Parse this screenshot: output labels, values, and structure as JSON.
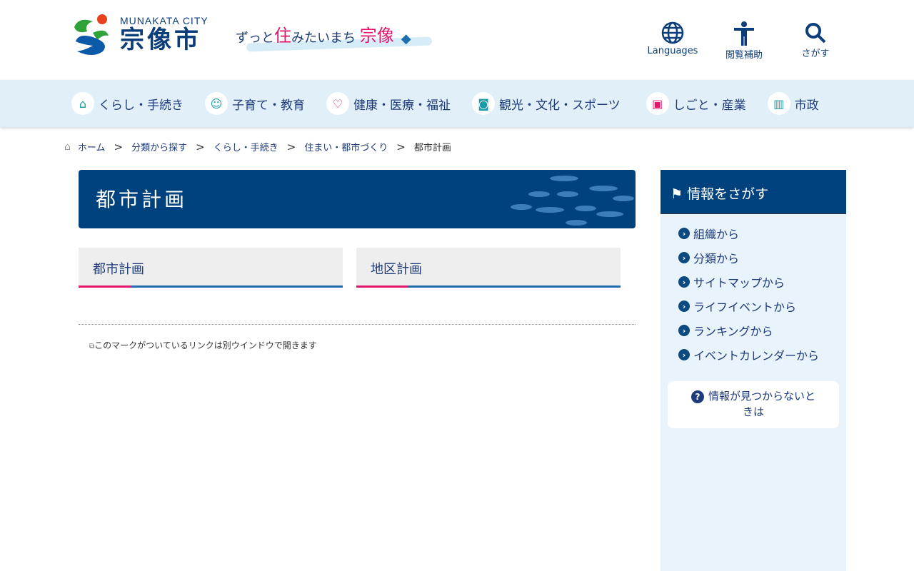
{
  "header": {
    "logo_en": "MUNAKATA CITY",
    "logo_jp": "宗像市",
    "slogan_1": "ずっと",
    "slogan_pk1": "住",
    "slogan_2": "みたいまち",
    "slogan_pk2": "宗像",
    "tools": [
      {
        "label": "Languages",
        "icon": "globe-icon"
      },
      {
        "label": "閲覧補助",
        "icon": "accessibility-icon"
      },
      {
        "label": "さがす",
        "icon": "search-icon"
      }
    ]
  },
  "nav": [
    {
      "label": "くらし・手続き",
      "icon": "house-icon"
    },
    {
      "label": "子育て・教育",
      "icon": "baby-icon"
    },
    {
      "label": "健康・医療・福祉",
      "icon": "heart-hand-icon"
    },
    {
      "label": "観光・文化・スポーツ",
      "icon": "camera-icon"
    },
    {
      "label": "しごと・産業",
      "icon": "briefcase-icon"
    },
    {
      "label": "市政",
      "icon": "building-icon"
    }
  ],
  "breadcrumb": {
    "items": [
      "ホーム",
      "分類から探す",
      "くらし・手続き",
      "住まい・都市づくり"
    ],
    "current": "都市計画",
    "sep": ">"
  },
  "main": {
    "title": "都市計画",
    "cards": [
      "都市計画",
      "地区計画"
    ],
    "note": "このマークがついているリンクは別ウインドウで開きます"
  },
  "side": {
    "title": "情報をさがす",
    "links": [
      "組織から",
      "分類から",
      "サイトマップから",
      "ライフイベントから",
      "ランキングから",
      "イベントカレンダーから"
    ],
    "help": "情報が見つからないときは"
  }
}
